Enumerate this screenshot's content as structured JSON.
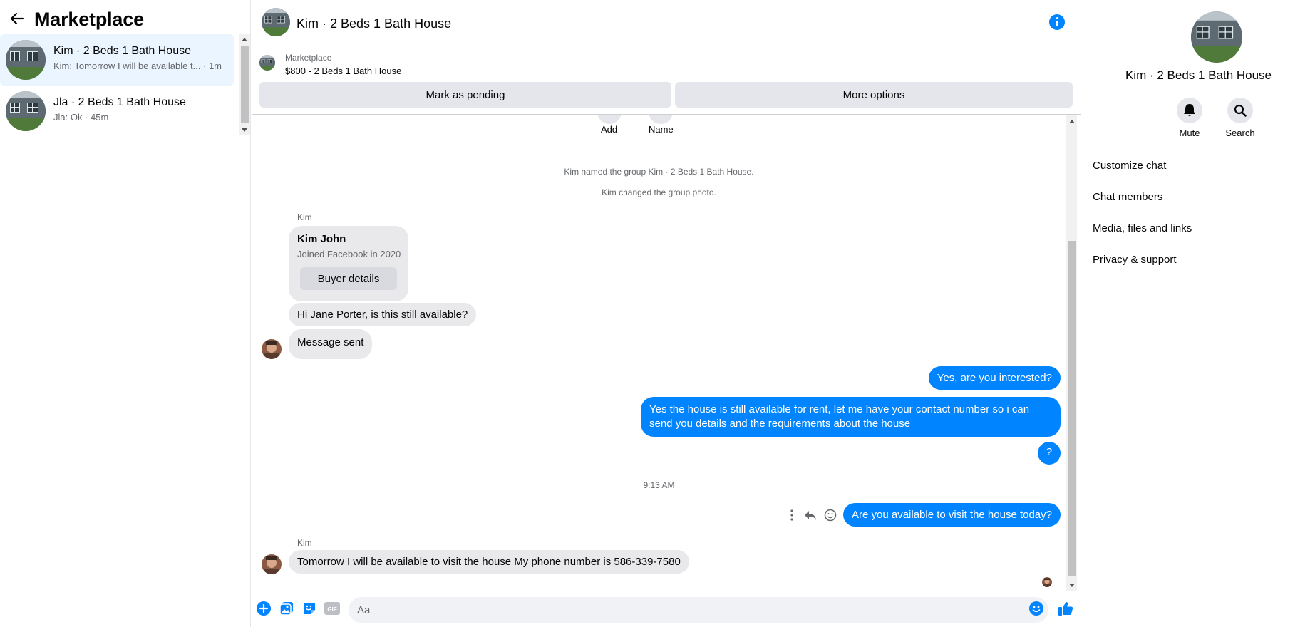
{
  "sidebar": {
    "title": "Marketplace",
    "conversations": [
      {
        "name": "Kim · 2 Beds 1 Bath House",
        "preview": "Kim: Tomorrow I will be available t... · 1m",
        "active": true
      },
      {
        "name": "Jla · 2 Beds 1 Bath House",
        "preview": "Jla: Ok · 45m",
        "active": false
      }
    ]
  },
  "header": {
    "title": "Kim · 2 Beds 1 Bath House",
    "info_icon": "info-icon"
  },
  "marketplace": {
    "label": "Marketplace",
    "listing": "$800 - 2 Beds 1 Bath House",
    "pending_label": "Mark as pending",
    "more_label": "More options"
  },
  "chat": {
    "actions": [
      {
        "label": "Add"
      },
      {
        "label": "Name"
      }
    ],
    "system_messages": [
      "Kim named the group Kim · 2 Beds 1 Bath House.",
      "Kim changed the group photo."
    ],
    "sender": "Kim",
    "card": {
      "name": "Kim John",
      "joined": "Joined Facebook in 2020",
      "button": "Buyer details"
    },
    "incoming_1": "Hi Jane Porter, is this still available?",
    "incoming_2": "Message sent",
    "outgoing_1": "Yes, are you interested?",
    "outgoing_2": "Yes the house is still available for rent, let me have your contact number so i can send you details and the requirements about the house",
    "outgoing_3": "?",
    "timestamp": "9:13 AM",
    "outgoing_4": "Are you available to visit the house today?",
    "sender_2": "Kim",
    "incoming_3": "Tomorrow I will be available to visit the house My phone number is 586-339-7580"
  },
  "composer": {
    "placeholder": "Aa",
    "icons": [
      "plus-icon",
      "image-icon",
      "sticker-icon",
      "gif-icon",
      "emoji-icon",
      "like-icon"
    ],
    "gif_label": "GIF"
  },
  "info_panel": {
    "title": "Kim · 2 Beds 1 Bath House",
    "mute_label": "Mute",
    "search_label": "Search",
    "items": [
      "Customize chat",
      "Chat members",
      "Media, files and links",
      "Privacy & support"
    ]
  },
  "colors": {
    "accent": "#0084ff",
    "active_row": "#ebf5ff",
    "bubble_in": "#e9e9eb"
  }
}
